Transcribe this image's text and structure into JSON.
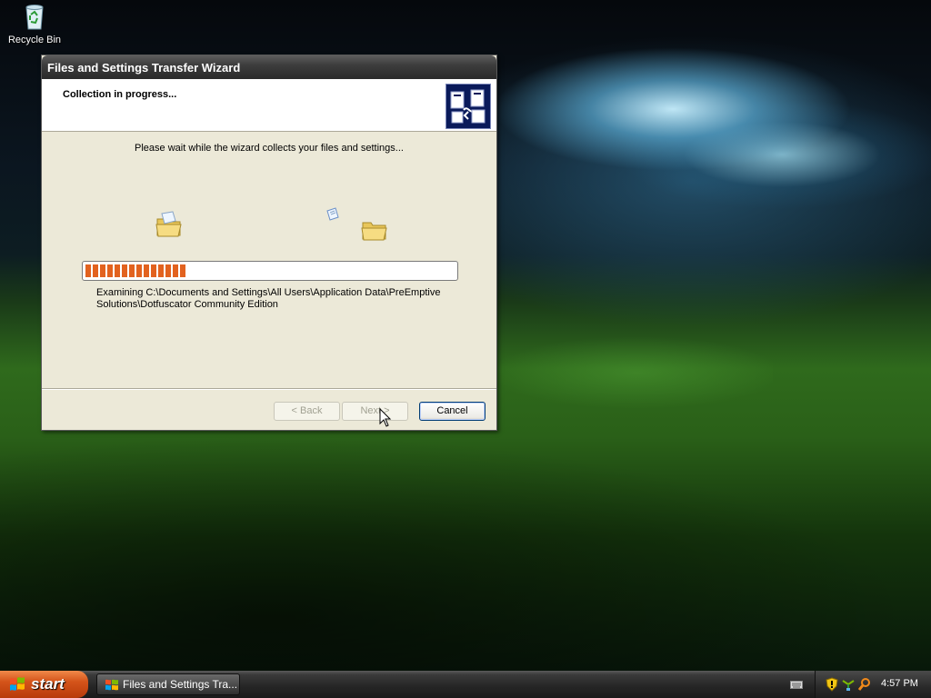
{
  "desktop": {
    "icons": [
      {
        "label": "Recycle Bin",
        "icon": "recycle-bin-icon"
      }
    ]
  },
  "wizard": {
    "title": "Files and Settings Transfer Wizard",
    "header_title": "Collection in progress...",
    "instruction": "Please wait while the wizard collects your files and settings...",
    "progress_percent": 27,
    "status_line1": "Examining C:\\Documents and Settings\\All Users\\Application Data\\PreEmptive",
    "status_line2": "Solutions\\Dotfuscator Community Edition",
    "buttons": {
      "back": "< Back",
      "next": "Next >",
      "cancel": "Cancel"
    }
  },
  "taskbar": {
    "start_label": "start",
    "tasks": [
      {
        "label": "Files and Settings Tra...",
        "icon": "transfer-wizard-icon"
      }
    ],
    "clock": "4:57 PM"
  },
  "colors": {
    "progress": "#e2621f",
    "start_button": "#d4541a",
    "taskbar": "#252525"
  }
}
